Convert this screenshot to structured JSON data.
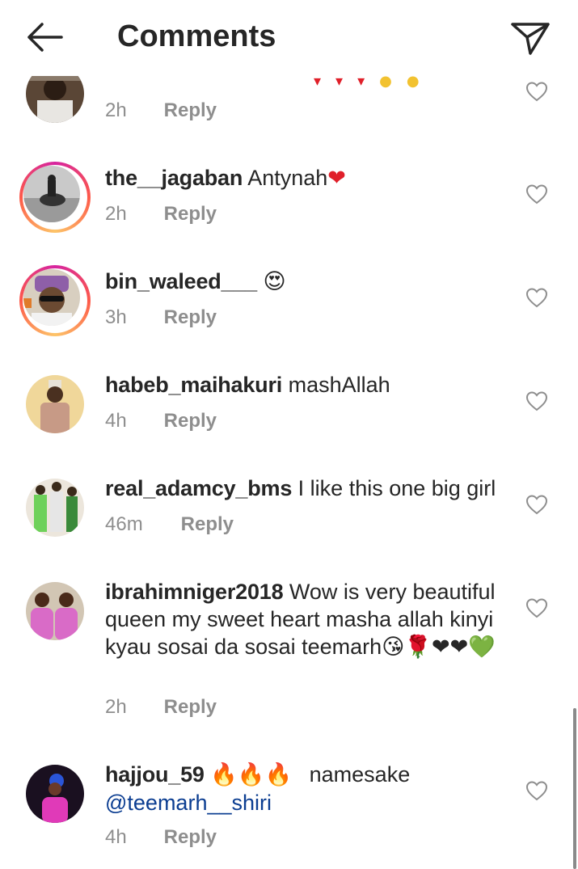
{
  "header": {
    "title": "Comments",
    "back_icon": "arrow-left-icon",
    "send_icon": "paper-plane-icon"
  },
  "comments": [
    {
      "username": "",
      "text": "",
      "time": "2h",
      "reply_label": "Reply",
      "story_ring": false,
      "partial": true
    },
    {
      "username": "the__jagaban",
      "text": "Antynah",
      "emoji": "❤",
      "time": "2h",
      "reply_label": "Reply",
      "story_ring": true
    },
    {
      "username": "bin_waleed___",
      "text": "",
      "emoji": "😍",
      "time": "3h",
      "reply_label": "Reply",
      "story_ring": true
    },
    {
      "username": "habeb_maihakuri",
      "text": "mashAllah",
      "time": "4h",
      "reply_label": "Reply",
      "story_ring": false
    },
    {
      "username": "real_adamcy_bms",
      "text": "I like this one big girl",
      "time": "46m",
      "reply_label": "Reply",
      "story_ring": false
    },
    {
      "username": "ibrahimniger2018",
      "text": "Wow is very beautiful queen my sweet heart masha allah kinyi kyau sosai da sosai teemarh",
      "emoji": "😘🌹❤❤💚",
      "time": "2h",
      "reply_label": "Reply",
      "story_ring": false
    },
    {
      "username": "hajjou_59",
      "text": "namesake",
      "emoji": "🔥🔥🔥",
      "mention": "@teemarh__shiri",
      "time": "4h",
      "reply_label": "Reply",
      "story_ring": false
    }
  ],
  "like_icon": "heart-outline-icon"
}
